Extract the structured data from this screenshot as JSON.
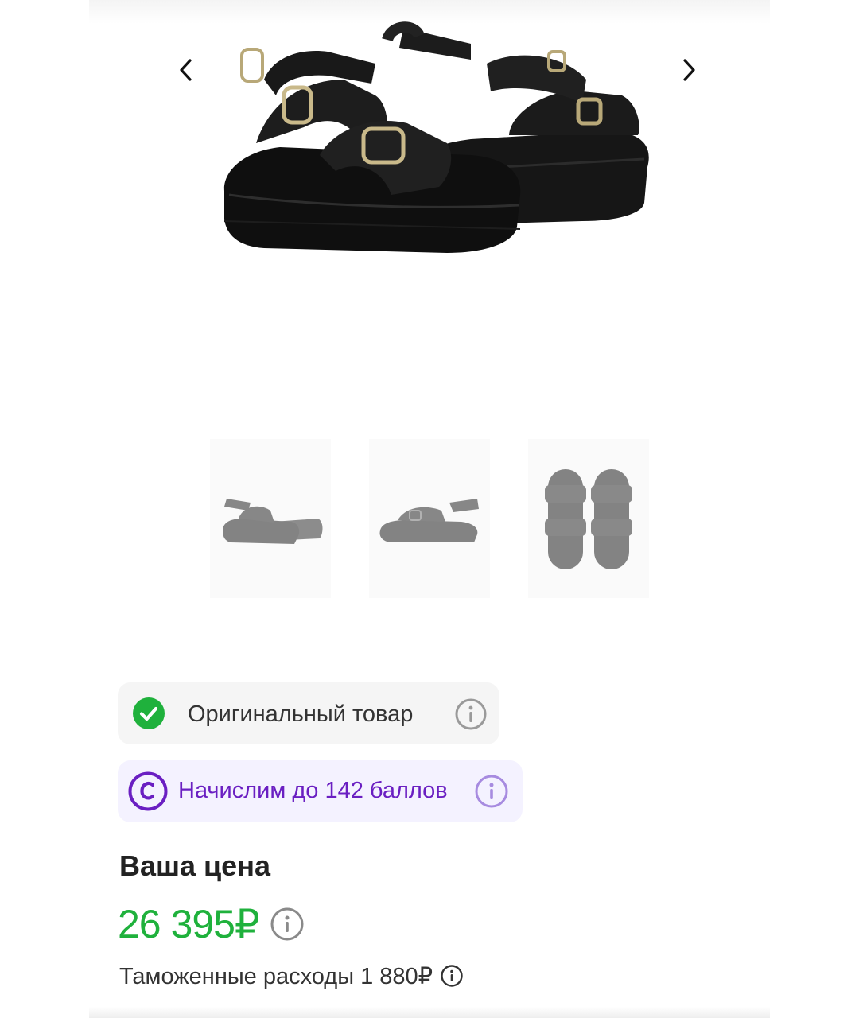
{
  "gallery": {
    "prev_icon": "chevron-left-icon",
    "next_icon": "chevron-right-icon",
    "thumbnails": [
      {
        "icon": "sandal-side-view"
      },
      {
        "icon": "sandal-side-view-alt"
      },
      {
        "icon": "sandal-top-view"
      }
    ]
  },
  "badges": {
    "original": {
      "label": "Оригинальный товар",
      "icon": "check-circle-icon",
      "info_icon": "info-icon",
      "color": "#1fb13c"
    },
    "bonus": {
      "label": "Начислим до 142 баллов",
      "icon": "bonus-coin-icon",
      "info_icon": "info-icon",
      "color": "#6a1fc2"
    }
  },
  "price": {
    "title": "Ваша цена",
    "value": "26 395₽",
    "color": "#1fb13c",
    "customs": "Таможенные расходы 1 880₽"
  }
}
